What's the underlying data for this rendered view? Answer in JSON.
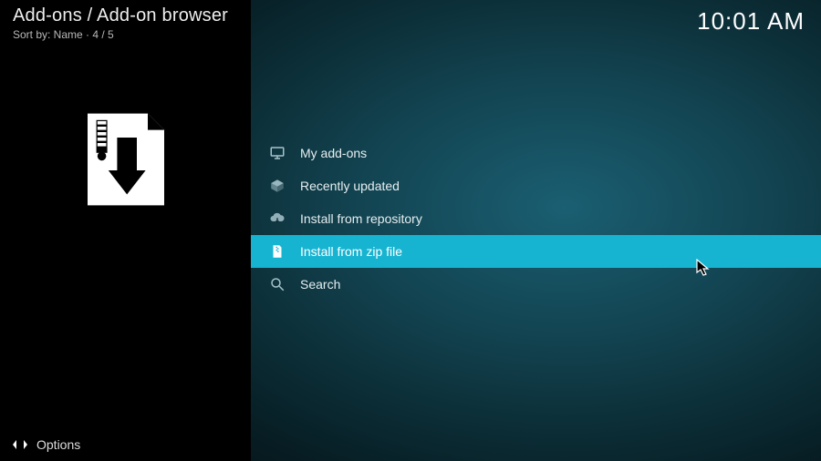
{
  "header": {
    "breadcrumb": "Add-ons / Add-on browser",
    "sort_line": "Sort by: Name  ·  4 / 5"
  },
  "clock": "10:01 AM",
  "menu": {
    "items": [
      {
        "label": "My add-ons"
      },
      {
        "label": "Recently updated"
      },
      {
        "label": "Install from repository"
      },
      {
        "label": "Install from zip file"
      },
      {
        "label": "Search"
      }
    ],
    "highlighted_index": 3
  },
  "footer": {
    "options_label": "Options"
  }
}
